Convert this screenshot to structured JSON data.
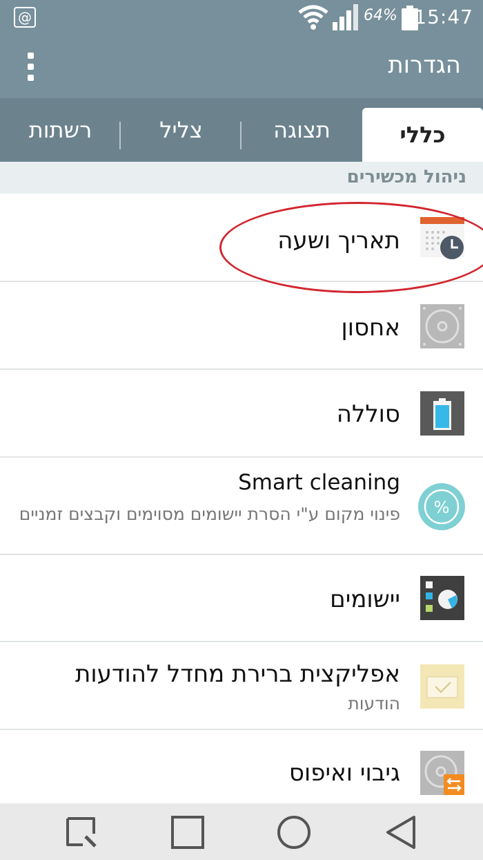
{
  "status_bar": {
    "notification_icon": "@",
    "battery_percent": "64%",
    "time": "15:47"
  },
  "app_bar": {
    "title": "הגדרות"
  },
  "tabs": [
    {
      "label": "כללי",
      "active": true
    },
    {
      "label": "תצוגה",
      "active": false
    },
    {
      "label": "צליל",
      "active": false
    },
    {
      "label": "רשתות",
      "active": false
    }
  ],
  "section_header": "ניהול מכשירים",
  "rows": [
    {
      "title": "תאריך ושעה",
      "subtitle": "",
      "icon": "calendar-clock-icon"
    },
    {
      "title": "אחסון",
      "subtitle": "",
      "icon": "storage-disk-icon"
    },
    {
      "title": "סוללה",
      "subtitle": "",
      "icon": "battery-icon"
    },
    {
      "title": "Smart cleaning",
      "subtitle": "פינוי מקום ע\"י הסרת יישומים מסוימים וקבצים זמניים",
      "icon": "percent-circle-icon"
    },
    {
      "title": "יישומים",
      "subtitle": "",
      "icon": "apps-icon"
    },
    {
      "title": "אפליקצית ברירת מחדל להודעות",
      "subtitle": "הודעות",
      "icon": "envelope-icon"
    },
    {
      "title": "גיבוי ואיפוס",
      "subtitle": "",
      "icon": "backup-reset-icon"
    }
  ],
  "colors": {
    "header_bg": "#77909b",
    "annotation": "#d2262f"
  }
}
